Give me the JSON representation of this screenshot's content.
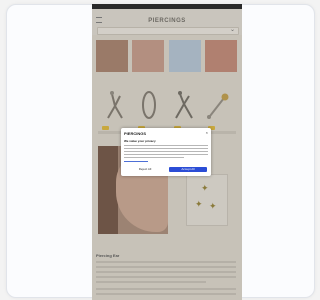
{
  "site": {
    "logo_text": "PIERCINGS"
  },
  "page": {
    "title": "Piercing Ear"
  },
  "cookie_modal": {
    "logo_text": "PIERCINGS",
    "title": "We value your privacy",
    "close_symbol": "×",
    "reject_label": "Reject All",
    "accept_label": "Accept All"
  },
  "icons": [
    "menu-icon",
    "chevron-down-icon",
    "close-icon",
    "star-icon"
  ],
  "colors": {
    "accept": "#2b4dd6",
    "overlay": "#c7c2b8",
    "badge": "#c8a83e"
  }
}
